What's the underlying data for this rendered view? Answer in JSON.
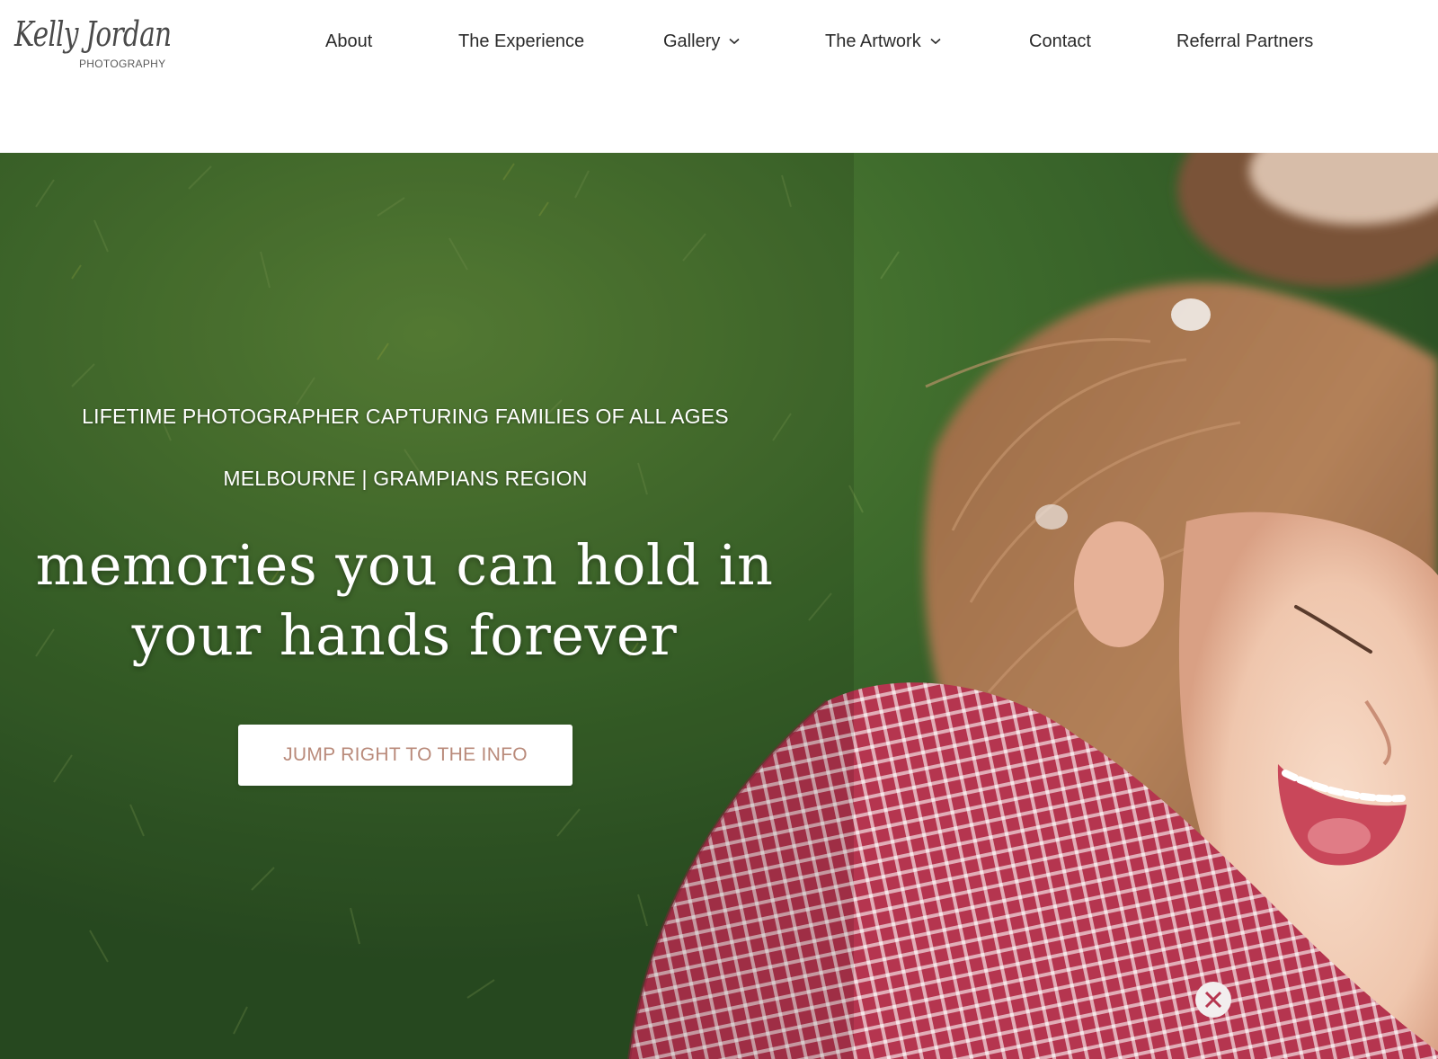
{
  "brand": {
    "logo_script": "Kelly Jordan",
    "logo_sub": "PHOTOGRAPHY"
  },
  "nav": {
    "about": "About",
    "experience": "The Experience",
    "gallery": "Gallery",
    "artwork": "The Artwork",
    "contact": "Contact",
    "referral": "Referral Partners"
  },
  "hero": {
    "eyebrow_1": "LIFETIME PHOTOGRAPHER CAPTURING FAMILIES OF ALL AGES",
    "eyebrow_2": "MELBOURNE | GRAMPIANS REGION",
    "headline_line1": "memories you can hold in",
    "headline_line2": "your hands forever",
    "cta_label": "JUMP RIGHT TO THE INFO"
  },
  "colors": {
    "nav_text": "#2a2a2a",
    "cta_text": "#b98a7a",
    "grass": "#3f6a2c",
    "shirt_red": "#b83a56"
  },
  "icons": {
    "gallery_dropdown": "chevron-down-icon",
    "artwork_dropdown": "chevron-down-icon"
  }
}
